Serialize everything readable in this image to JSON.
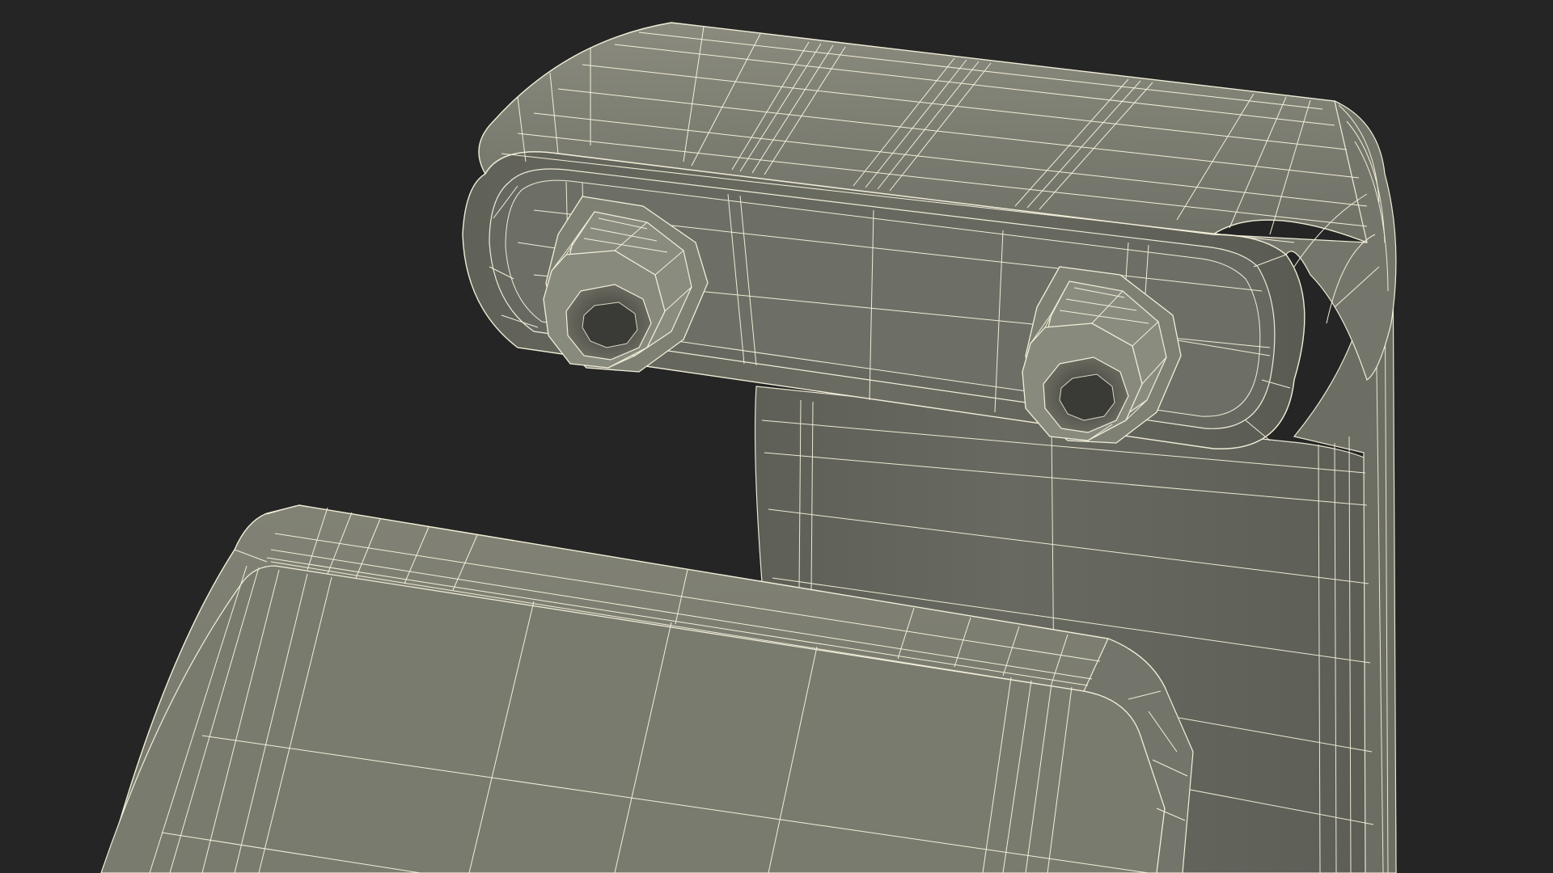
{
  "scene": {
    "background_color": "#252525",
    "surface_color": "#7b7c6f",
    "shadow_color": "#5f6058",
    "wire_color": "#f4f1dc",
    "bolt_color": "#8a8a7d"
  }
}
